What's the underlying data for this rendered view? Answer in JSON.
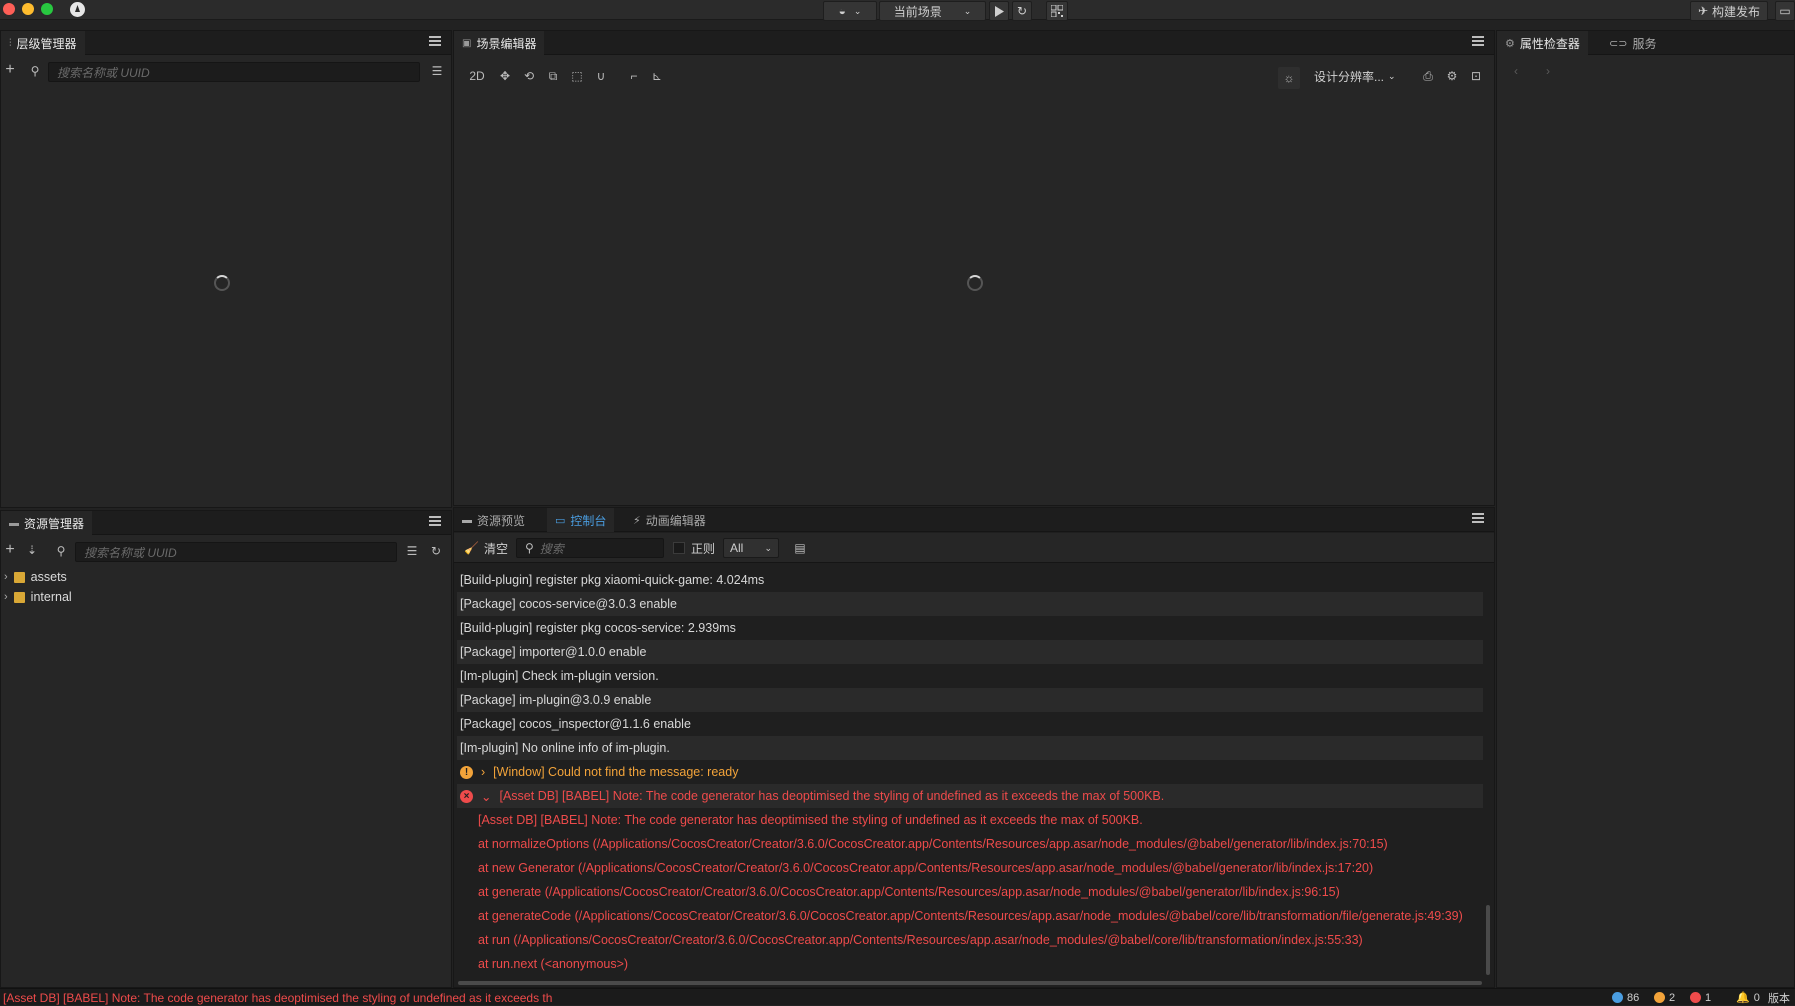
{
  "titlebar": {
    "scene_label": "当前场景",
    "build_label": "构建发布"
  },
  "hierarchy": {
    "title": "层级管理器",
    "search_placeholder": "搜索名称或 UUID"
  },
  "scene_editor": {
    "title": "场景编辑器",
    "mode_2d": "2D",
    "resolution_label": "设计分辨率..."
  },
  "inspector": {
    "tab_properties": "属性检查器",
    "tab_services": "服务"
  },
  "assets": {
    "title": "资源管理器",
    "search_placeholder": "搜索名称或 UUID",
    "tree": [
      {
        "label": "assets"
      },
      {
        "label": "internal"
      }
    ]
  },
  "bottom_tabs": {
    "preview": "资源预览",
    "console": "控制台",
    "animation": "动画编辑器"
  },
  "console": {
    "clear_label": "清空",
    "search_placeholder": "搜索",
    "regex_label": "正则",
    "filter_value": "All",
    "lines": [
      {
        "text": "[Build-plugin] register pkg xiaomi-quick-game: 4.024ms"
      },
      {
        "text": "[Package] cocos-service@3.0.3 enable"
      },
      {
        "text": "[Build-plugin] register pkg cocos-service: 2.939ms"
      },
      {
        "text": "[Package] importer@1.0.0 enable"
      },
      {
        "text": "[Im-plugin] Check im-plugin version."
      },
      {
        "text": "[Package] im-plugin@3.0.9 enable"
      },
      {
        "text": "[Package] cocos_inspector@1.1.6 enable"
      },
      {
        "text": "[Im-plugin] No online info of im-plugin."
      }
    ],
    "warning": "[Window] Could not find the message: ready",
    "error": "[Asset DB] [BABEL] Note: The code generator has deoptimised the styling of undefined as it exceeds the max of 500KB.",
    "error_details": [
      "[Asset DB] [BABEL] Note: The code generator has deoptimised the styling of undefined as it exceeds the max of 500KB.",
      "at normalizeOptions (/Applications/CocosCreator/Creator/3.6.0/CocosCreator.app/Contents/Resources/app.asar/node_modules/@babel/generator/lib/index.js:70:15)",
      "at new Generator (/Applications/CocosCreator/Creator/3.6.0/CocosCreator.app/Contents/Resources/app.asar/node_modules/@babel/generator/lib/index.js:17:20)",
      "at generate (/Applications/CocosCreator/Creator/3.6.0/CocosCreator.app/Contents/Resources/app.asar/node_modules/@babel/generator/lib/index.js:96:15)",
      "at generateCode (/Applications/CocosCreator/Creator/3.6.0/CocosCreator.app/Contents/Resources/app.asar/node_modules/@babel/core/lib/transformation/file/generate.js:49:39)",
      "at run (/Applications/CocosCreator/Creator/3.6.0/CocosCreator.app/Contents/Resources/app.asar/node_modules/@babel/core/lib/transformation/index.js:55:33)",
      "at run.next (<anonymous>)"
    ]
  },
  "statusbar": {
    "message": "[Asset DB] [BABEL] Note: The code generator has deoptimised the styling of undefined as it exceeds th",
    "info_count": "86",
    "warn_count": "2",
    "error_count": "1",
    "notify_count": "0",
    "version_label": "版本"
  },
  "colors": {
    "accent": "#4a9de0",
    "warning": "#f2a33a",
    "error": "#ee4b4b"
  }
}
